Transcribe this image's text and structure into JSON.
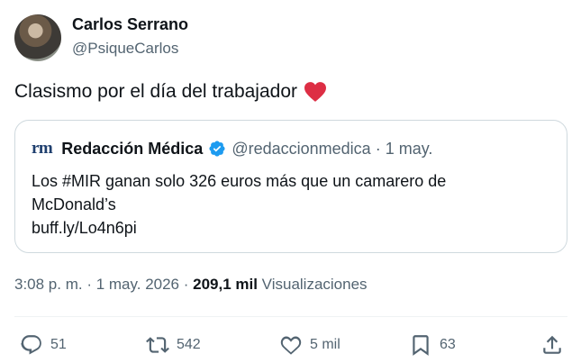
{
  "author": {
    "name": "Carlos Serrano",
    "handle": "@PsiqueCarlos"
  },
  "tweet": {
    "text": "Clasismo por el día del trabajador"
  },
  "quote": {
    "logo": "rm",
    "name": "Redacción Médica",
    "handle": "@redaccionmedica",
    "separator": "·",
    "date": "1 may.",
    "lines": [
      "Los #MIR ganan solo 326 euros más que un camarero de",
      "McDonald’s",
      "buff.ly/Lo4n6pi"
    ]
  },
  "meta": {
    "time": "3:08 p. m.",
    "sep1": " · ",
    "date": "1 may. 2026",
    "sep2": " · ",
    "views_count": "209,1 mil",
    "views_label": " Visualizaciones"
  },
  "actions": {
    "replies": "51",
    "retweets": "542",
    "likes": "5 mil",
    "bookmarks": "63"
  },
  "colors": {
    "text": "#0f1419",
    "secondary": "#536471",
    "verified": "#1d9bf0",
    "heart": "#e0245e"
  }
}
